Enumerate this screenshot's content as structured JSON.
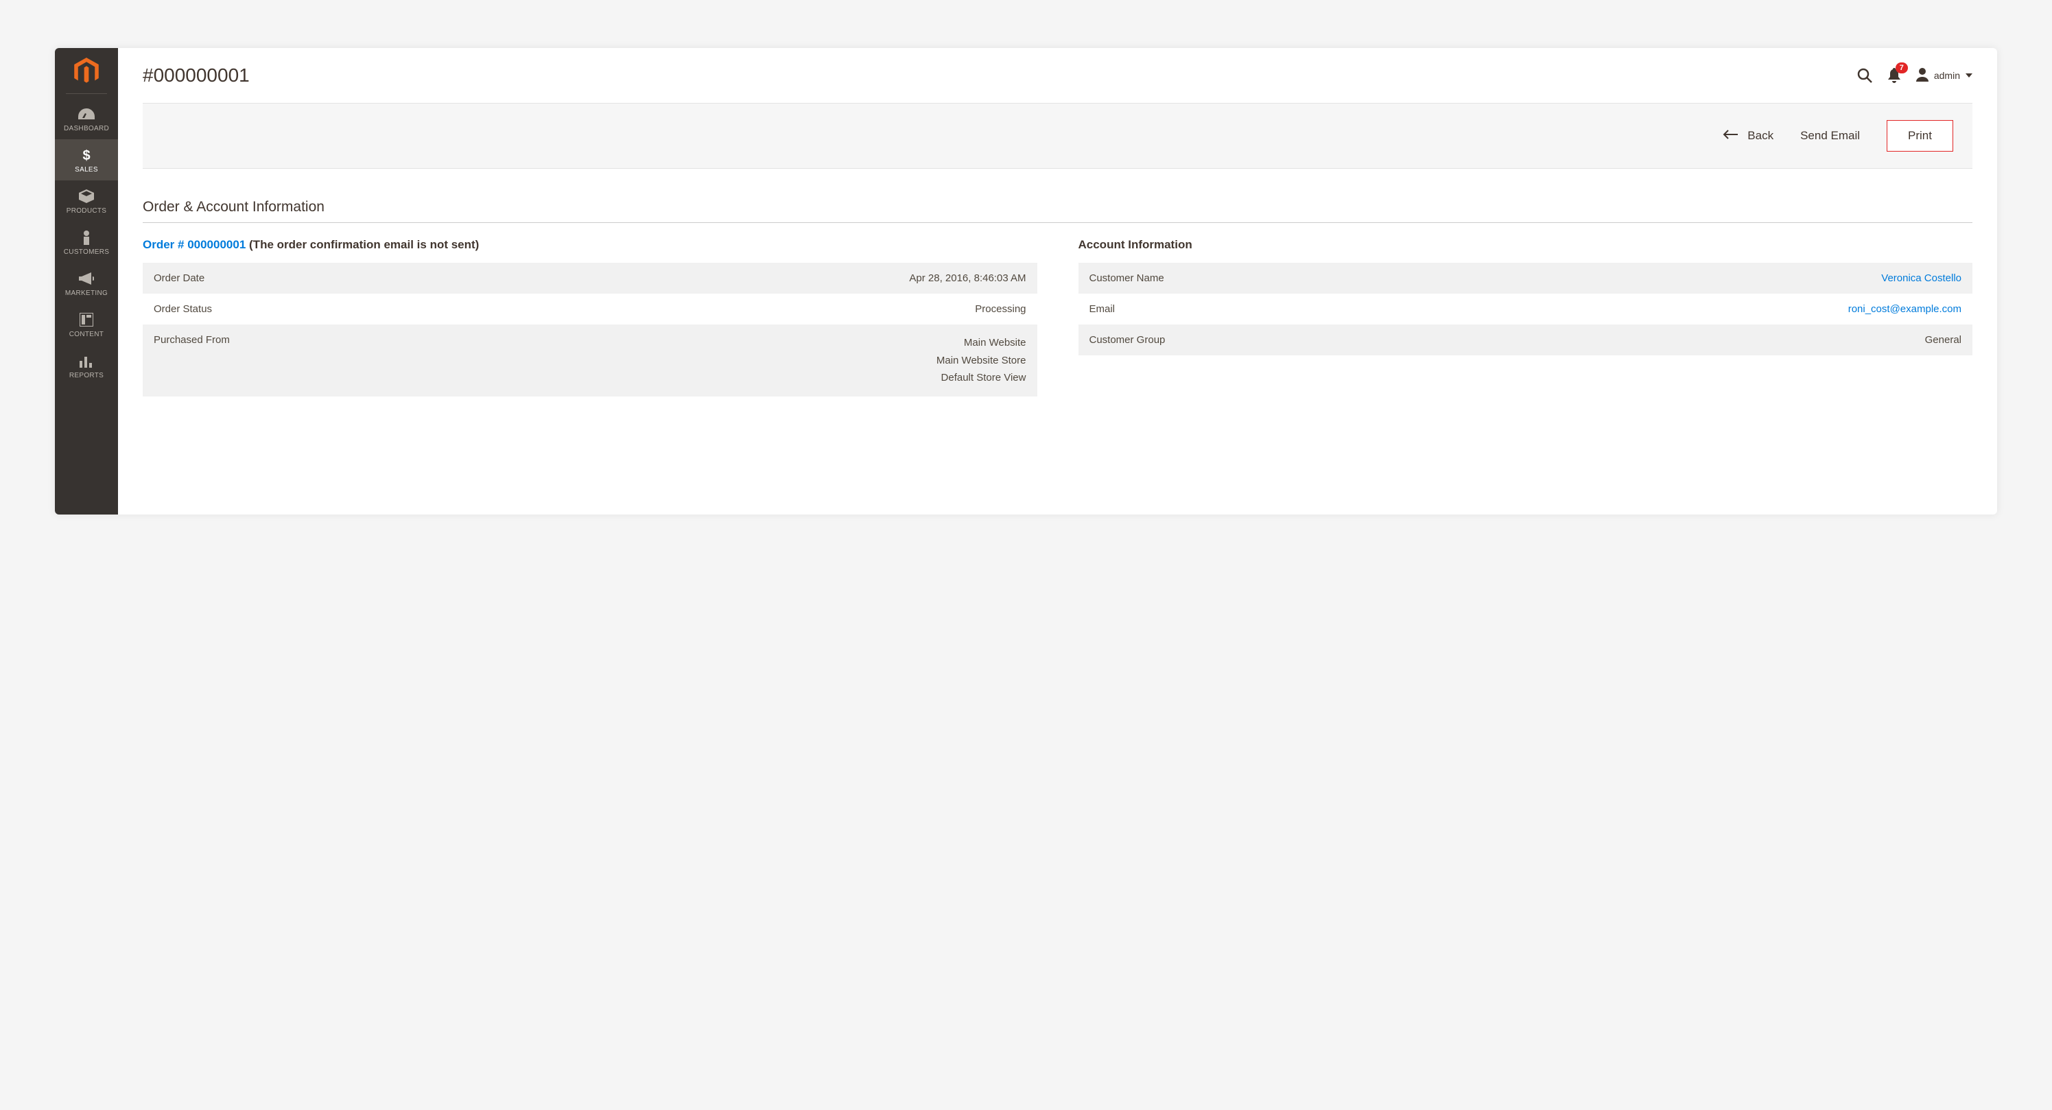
{
  "header": {
    "title": "#000000001",
    "notification_count": "7",
    "username": "admin"
  },
  "sidebar": {
    "items": [
      {
        "label": "DASHBOARD"
      },
      {
        "label": "SALES"
      },
      {
        "label": "PRODUCTS"
      },
      {
        "label": "CUSTOMERS"
      },
      {
        "label": "MARKETING"
      },
      {
        "label": "CONTENT"
      },
      {
        "label": "REPORTS"
      }
    ]
  },
  "actions": {
    "back": "Back",
    "send_email": "Send Email",
    "print": "Print"
  },
  "section": {
    "title": "Order & Account Information",
    "order_heading_prefix": "Order # 000000001",
    "order_heading_suffix": " (The order confirmation email is not sent)",
    "account_heading": "Account Information"
  },
  "order_info": {
    "rows": [
      {
        "label": "Order Date",
        "value": "Apr 28, 2016, 8:46:03 AM"
      },
      {
        "label": "Order Status",
        "value": "Processing"
      },
      {
        "label": "Purchased From",
        "value_lines": [
          "Main Website",
          "Main Website Store",
          "Default Store View"
        ]
      }
    ]
  },
  "account_info": {
    "rows": [
      {
        "label": "Customer Name",
        "value": "Veronica Costello",
        "link": true
      },
      {
        "label": "Email",
        "value": "roni_cost@example.com",
        "link": true
      },
      {
        "label": "Customer Group",
        "value": "General",
        "link": false
      }
    ]
  }
}
